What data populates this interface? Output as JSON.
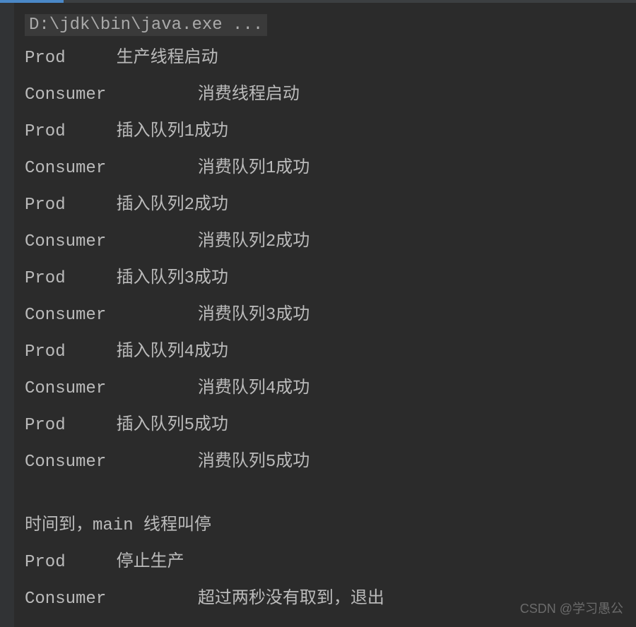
{
  "command": "D:\\jdk\\bin\\java.exe ...",
  "lines": [
    "Prod\t 生产线程启动",
    "Consumer\t 消费线程启动",
    "Prod\t 插入队列1成功",
    "Consumer\t 消费队列1成功",
    "Prod\t 插入队列2成功",
    "Consumer\t 消费队列2成功",
    "Prod\t 插入队列3成功",
    "Consumer\t 消费队列3成功",
    "Prod\t 插入队列4成功",
    "Consumer\t 消费队列4成功",
    "Prod\t 插入队列5成功",
    "Consumer\t 消费队列5成功",
    "",
    "时间到，main 线程叫停",
    "Prod\t 停止生产",
    "Consumer\t 超过两秒没有取到，退出"
  ],
  "watermark": "CSDN @学习愚公"
}
